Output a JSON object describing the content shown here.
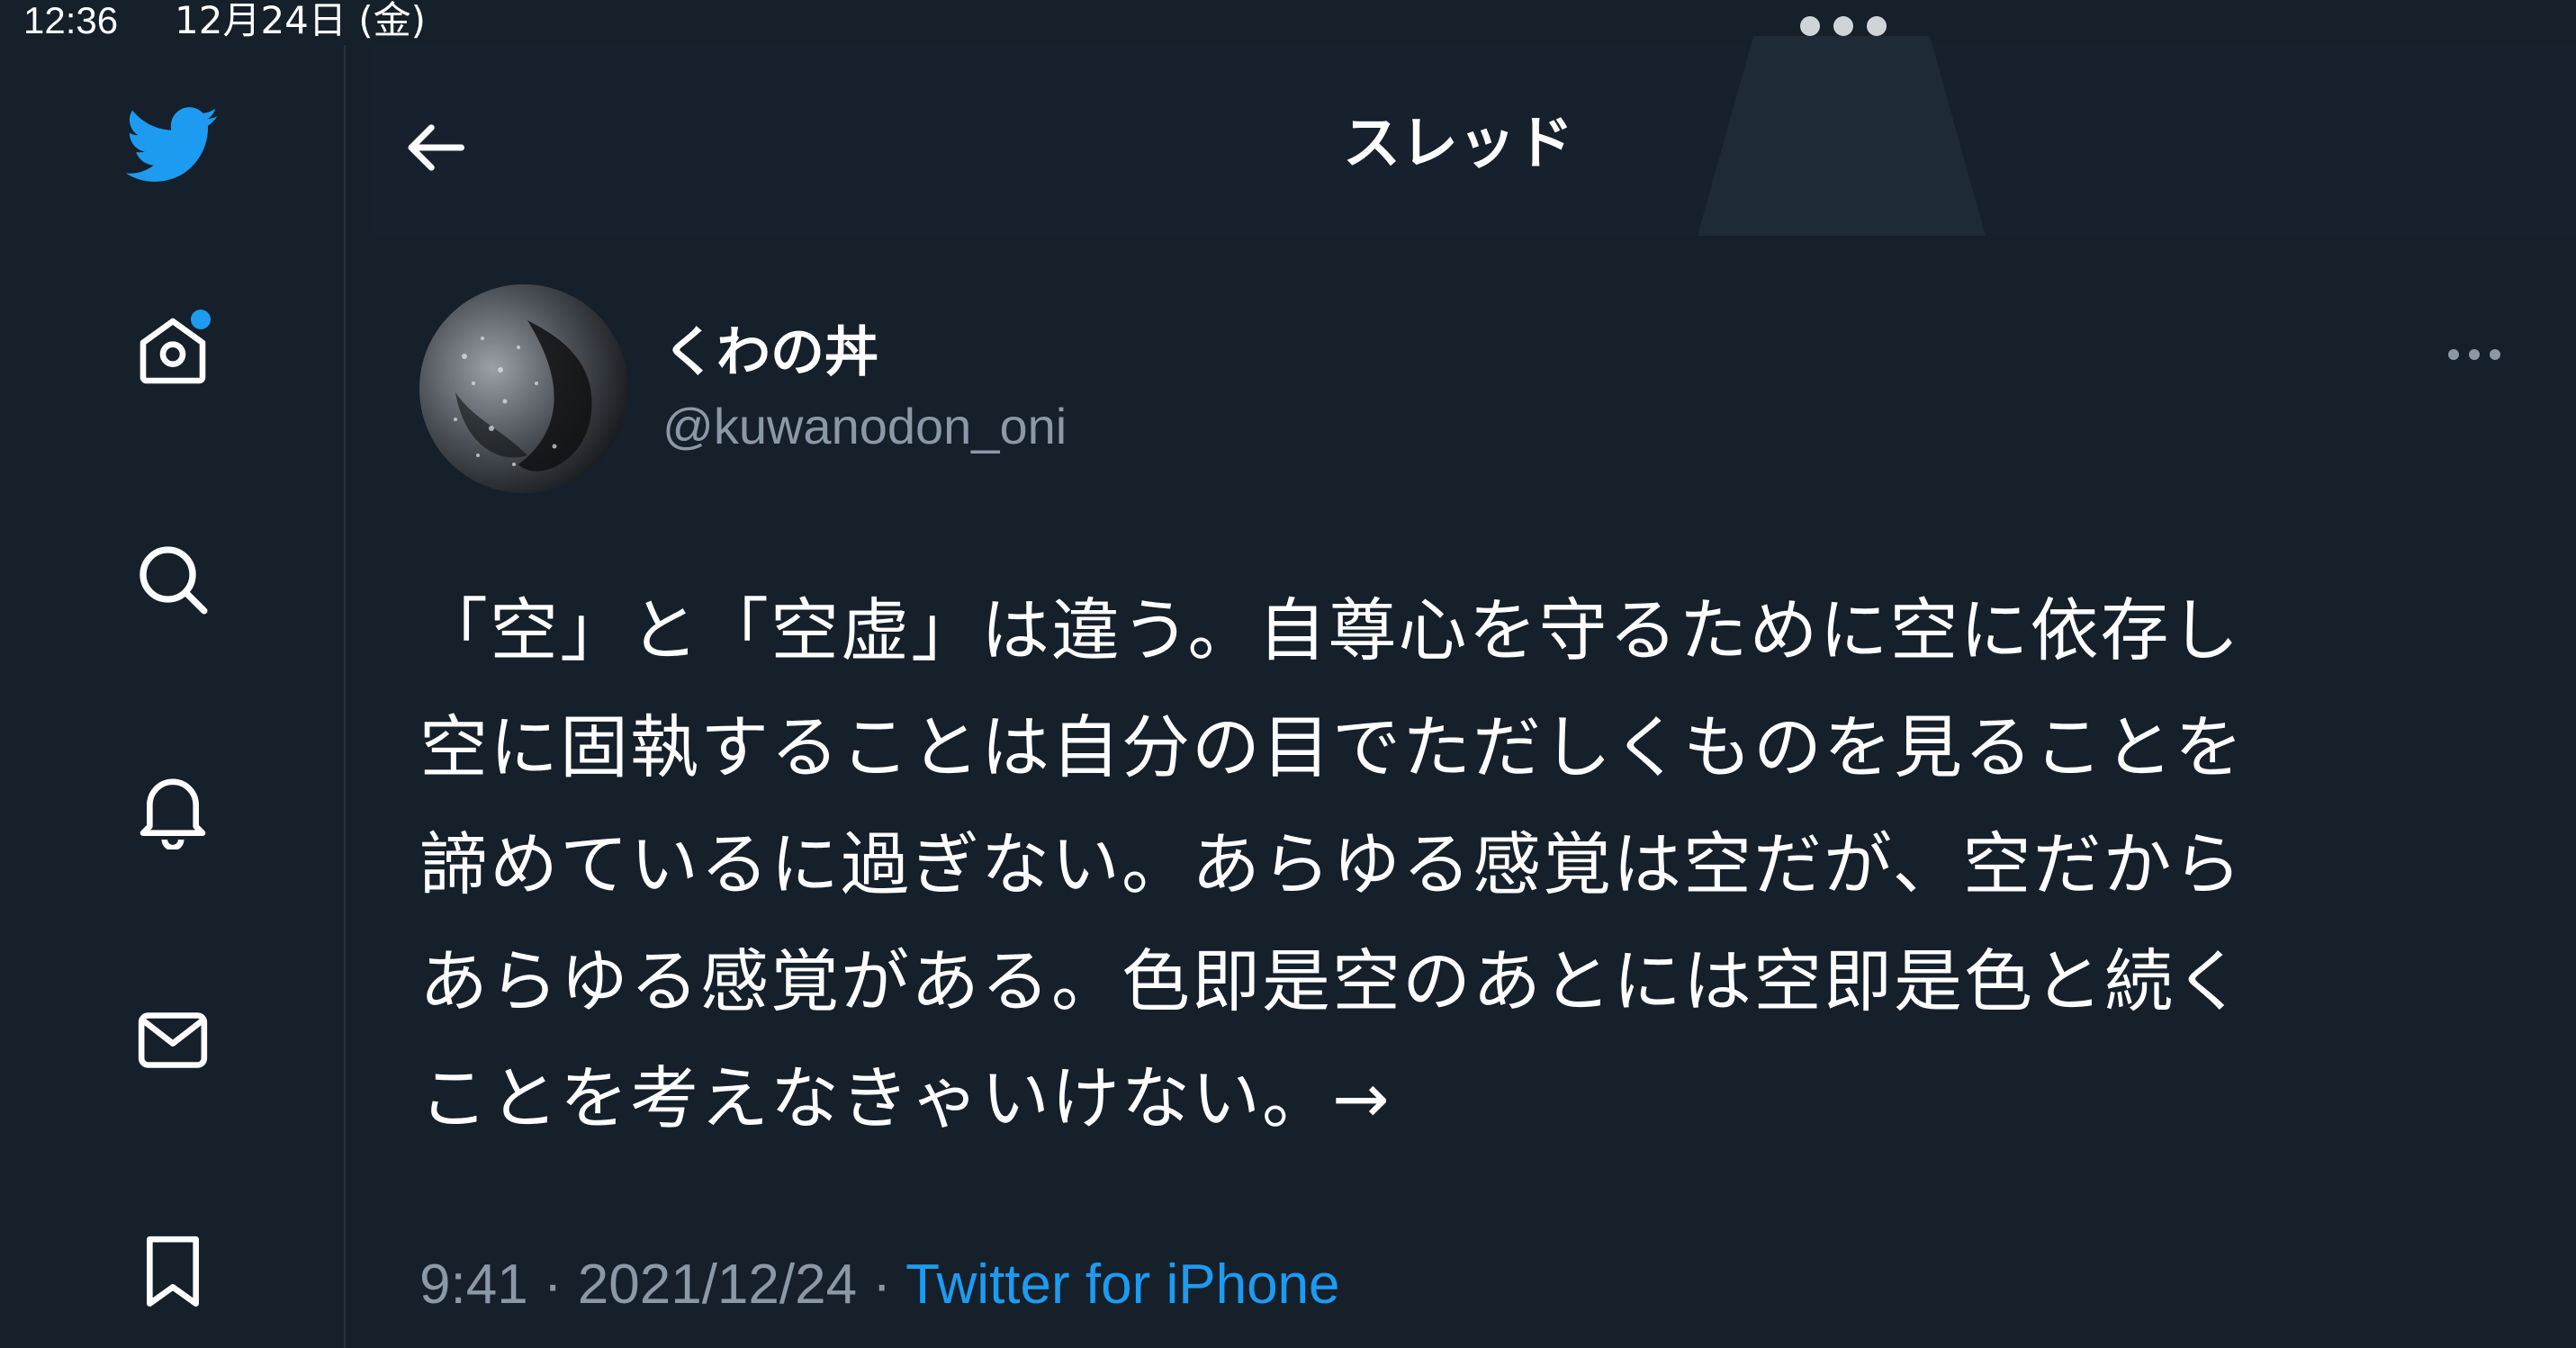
{
  "status_bar": {
    "time": "12:36",
    "date": "12月24日 (金)"
  },
  "sidebar": {
    "items": [
      {
        "icon": "twitter-bird-icon"
      },
      {
        "icon": "home-icon",
        "has_notification_dot": true
      },
      {
        "icon": "search-icon"
      },
      {
        "icon": "bell-icon"
      },
      {
        "icon": "mail-icon"
      },
      {
        "icon": "bookmark-icon"
      }
    ]
  },
  "header": {
    "title": "スレッド"
  },
  "tweet": {
    "display_name": "くわの丼",
    "handle": "@kuwanodon_oni",
    "text": "「空」と「空虚」は違う。自尊心を守るために空に依存し\n空に固執することは自分の目でただしくものを見ることを\n諦めているに過ぎない。あらゆる感覚は空だが、空だから\nあらゆる感覚がある。色即是空のあとには空即是色と続く\nことを考えなきゃいけない。→",
    "time": "9:41",
    "separator": " · ",
    "date": "2021/12/24",
    "source": "Twitter for iPhone"
  },
  "colors": {
    "background": "#15202b",
    "accent": "#1d9bf0",
    "secondary_text": "#8b98a5"
  }
}
